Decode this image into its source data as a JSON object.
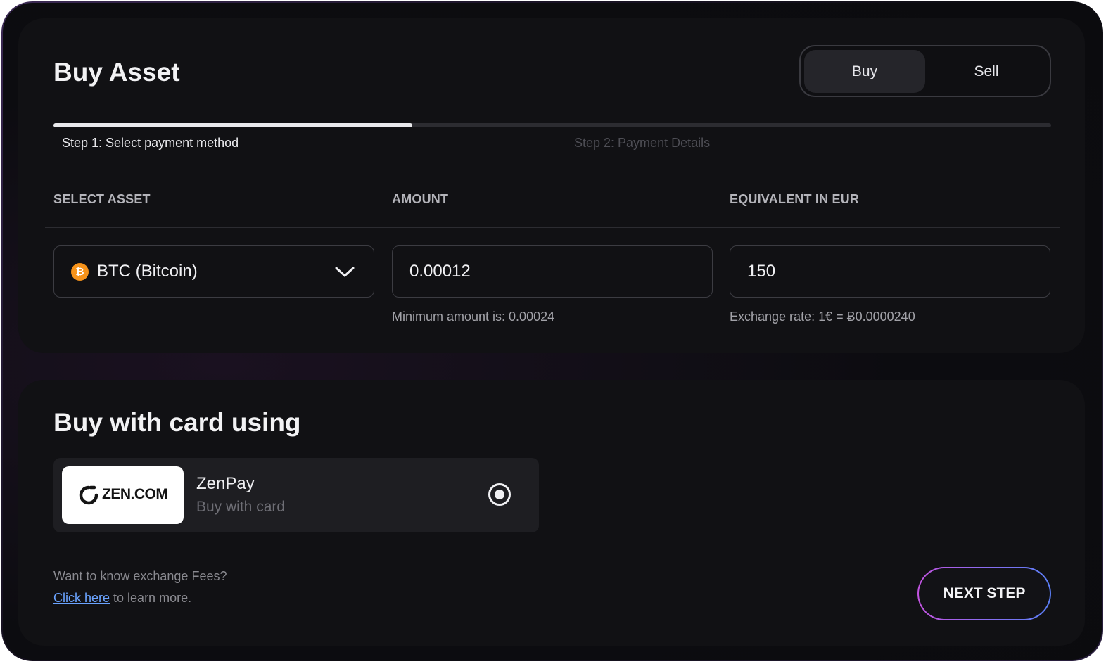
{
  "header": {
    "title": "Buy Asset",
    "toggle": {
      "buy_label": "Buy",
      "sell_label": "Sell",
      "selected": "Buy"
    }
  },
  "steps": {
    "progress_fraction": 0.36,
    "step1_label": "Step 1: Select payment method",
    "step2_label": "Step 2: Payment Details"
  },
  "form": {
    "columns": {
      "asset": "SELECT ASSET",
      "amount": "AMOUNT",
      "eur": "EQUIVALENT IN EUR"
    },
    "asset_value": "BTC (Bitcoin)",
    "asset_icon": "bitcoin-icon",
    "amount_value": "0.00012",
    "eur_value": "150",
    "amount_hint": "Minimum amount is: 0.00024",
    "eur_hint": "Exchange rate: 1€ = Ƀ0.0000240"
  },
  "payment": {
    "title": "Buy with card using",
    "method": {
      "logo_text": "ZEN.COM",
      "name": "ZenPay",
      "subtitle": "Buy with card",
      "selected": true
    }
  },
  "footer": {
    "fee_question": "Want to know exchange Fees?",
    "link_text": "Click here",
    "link_suffix": " to learn more.",
    "next_label": "NEXT STEP"
  },
  "colors": {
    "accent_link": "#6aa3ff",
    "bitcoin_orange": "#f7931a",
    "button_gradient_start": "#c253e0",
    "button_gradient_end": "#5a7ef5"
  }
}
